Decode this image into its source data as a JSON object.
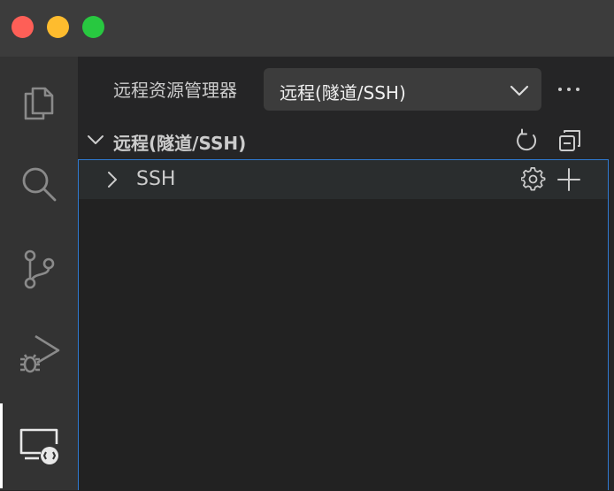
{
  "window": {
    "controls": [
      "close",
      "minimize",
      "maximize"
    ],
    "colors": {
      "close": "#fe5f57",
      "minimize": "#febc2e",
      "maximize": "#28c840"
    }
  },
  "activity_bar": {
    "items": [
      {
        "icon": "files-icon",
        "active": false
      },
      {
        "icon": "search-icon",
        "active": false
      },
      {
        "icon": "source-control-icon",
        "active": false
      },
      {
        "icon": "run-debug-icon",
        "active": false
      },
      {
        "icon": "remote-explorer-icon",
        "active": true
      }
    ]
  },
  "sidebar": {
    "title": "远程资源管理器",
    "selector": {
      "value": "远程(隧道/SSH)"
    },
    "more_icon": "ellipsis-icon",
    "section": {
      "title": "远程(隧道/SSH)",
      "expanded": true,
      "actions": [
        "refresh-icon",
        "collapse-all-icon"
      ]
    },
    "tree": [
      {
        "label": "SSH",
        "expanded": false,
        "actions": [
          "gear-icon",
          "add-icon"
        ]
      }
    ]
  },
  "colors": {
    "focus_border": "#2f7ad1",
    "activity_bar_bg": "#333333",
    "sidebar_bg": "#252526",
    "titlebar_bg": "#3c3c3c"
  }
}
